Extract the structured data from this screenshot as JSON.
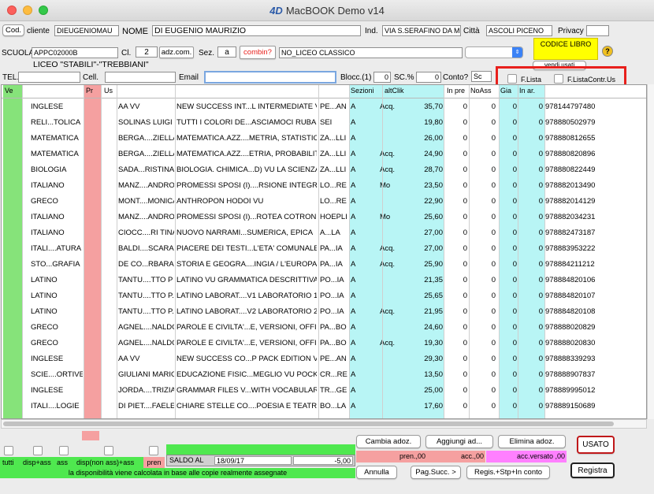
{
  "window": {
    "title": "MacBOOK  Demo v14",
    "logo": "4D"
  },
  "cliente": {
    "cod_btn": "Cod.",
    "label": "cliente",
    "code": "DIEUGENIOMAU",
    "nome_label": "NOME",
    "nome": "DI EUGENIO MAURIZIO",
    "ind_label": "Ind.",
    "ind": "VIA S.SERAFINO DA MO",
    "citta_label": "Città",
    "citta": "ASCOLI PICENO",
    "privacy_label": "Privacy",
    "privacy": ""
  },
  "scuola": {
    "label": "SCUOLA",
    "code": "APPC02000B",
    "cl_label": "Cl.",
    "cl": "2",
    "adz_btn": "adz.com.",
    "sez_label": "Sez.",
    "sez": "a",
    "combin_btn": "combin?",
    "tipo": "NO_LICEO CLASSICO",
    "nome": "LICEO \"STABILI\"-\"TREBBIANI\"",
    "codice_libro": "CODICE LIBRO",
    "help": "?"
  },
  "contatti": {
    "tel_label": "TEL.",
    "tel": "",
    "cell_label": "Cell.",
    "cell": "",
    "email_label": "Email",
    "email": "",
    "blocc_label": "Blocc.(1)",
    "blocc": "0",
    "sc_label": "SC.%",
    "sc": "0",
    "conto_label": "Conto?",
    "conto": "Sc",
    "vendi_btn": "vendi usati"
  },
  "filters": {
    "flista": "F.Lista",
    "flistacontr": "F.ListaContr.Us"
  },
  "colors": {
    "green": "#86e37a",
    "pink": "#f5a0a0",
    "cyan": "#b8f5f5",
    "magenta": "#ff80ff",
    "red_frame": "#e8201c"
  },
  "headers": [
    "Ve",
    "",
    "Pr",
    "Us",
    "",
    "",
    "",
    "",
    "Sezioni",
    "altClik",
    "",
    "In pre",
    "NoAss",
    "Gia",
    "In ar.",
    ""
  ],
  "rows": [
    {
      "mat": "INGLESE",
      "aut": "AA VV",
      "tit": "NEW SUCCESS INT...L INTERMEDIATE VU",
      "ed": "PE...AN",
      "sez": "A",
      "alt": "Acq.",
      "pr": "35,70",
      "inpre": "0",
      "noass": "0",
      "gia": "0",
      "inar": "0",
      "isbn": "978144797480"
    },
    {
      "mat": "RELI...TOLICA",
      "aut": "SOLINAS LUIGI",
      "tit": "TUTTI I COLORI DE...ASCIAMOCI RUBARE",
      "ed": "SEI",
      "sez": "A",
      "alt": "",
      "pr": "19,80",
      "inpre": "0",
      "noass": "0",
      "gia": "0",
      "inar": "0",
      "isbn": "978880502979"
    },
    {
      "mat": "MATEMATICA",
      "aut": "BERGA....ZIELLA",
      "tit": "MATEMATICA.AZZ....METRIA, STATISTICA",
      "ed": "ZA...LLI",
      "sez": "A",
      "alt": "",
      "pr": "26,00",
      "inpre": "0",
      "noass": "0",
      "gia": "0",
      "inar": "0",
      "isbn": "978880812655"
    },
    {
      "mat": "MATEMATICA",
      "aut": "BERGA....ZIELLA",
      "tit": "MATEMATICA.AZZ....ETRIA, PROBABILITA",
      "ed": "ZA...LLI",
      "sez": "A",
      "alt": "Acq.",
      "pr": "24,90",
      "inpre": "0",
      "noass": "0",
      "gia": "0",
      "inar": "0",
      "isbn": "978880820896"
    },
    {
      "mat": "BIOLOGIA",
      "aut": "SADA...RISTINA",
      "tit": "BIOLOGIA. CHIMICA...D) VU LA SCIENZA",
      "ed": "ZA...LLI",
      "sez": "A",
      "alt": "Acq.",
      "pr": "28,70",
      "inpre": "0",
      "noass": "0",
      "gia": "0",
      "inar": "0",
      "isbn": "978880822449"
    },
    {
      "mat": "ITALIANO",
      "aut": "MANZ....ANDRO",
      "tit": "PROMESSI SPOSI (I)....RSIONE INTEGRALE",
      "ed": "LO...RE",
      "sez": "A",
      "alt": "Mo",
      "pr": "23,50",
      "inpre": "0",
      "noass": "0",
      "gia": "0",
      "inar": "0",
      "isbn": "978882013490"
    },
    {
      "mat": "GRECO",
      "aut": "MONT....MONICA",
      "tit": "ANTHROPON HODOI VU",
      "ed": "LO...RE",
      "sez": "A",
      "alt": "",
      "pr": "22,90",
      "inpre": "0",
      "noass": "0",
      "gia": "0",
      "inar": "0",
      "isbn": "978882014129"
    },
    {
      "mat": "ITALIANO",
      "aut": "MANZ....ANDRO",
      "tit": "PROMESSI SPOSI (I)...ROTEA COTRONEO",
      "ed": "HOEPLI",
      "sez": "A",
      "alt": "Mo",
      "pr": "25,60",
      "inpre": "0",
      "noass": "0",
      "gia": "0",
      "inar": "0",
      "isbn": "978882034231"
    },
    {
      "mat": "ITALIANO",
      "aut": "CIOCC....RI TINA",
      "tit": "NUOVO NARRAMI...SUMERICA, EPICA",
      "ed": "A...LA",
      "sez": "A",
      "alt": "",
      "pr": "27,00",
      "inpre": "0",
      "noass": "0",
      "gia": "0",
      "inar": "0",
      "isbn": "978882473187"
    },
    {
      "mat": "ITALI....ATURA",
      "aut": "BALDI....SCARA",
      "tit": "PIACERE DEI TESTI...L'ETA' COMUNALE",
      "ed": "PA...IA",
      "sez": "A",
      "alt": "Acq.",
      "pr": "27,00",
      "inpre": "0",
      "noass": "0",
      "gia": "0",
      "inar": "0",
      "isbn": "978883953222"
    },
    {
      "mat": "STO...GRAFIA",
      "aut": "DE CO...RBARA",
      "tit": "STORIA E GEOGRA....INGIA / L'EUROPA E",
      "ed": "PA...IA",
      "sez": "A",
      "alt": "Acq.",
      "pr": "25,90",
      "inpre": "0",
      "noass": "0",
      "gia": "0",
      "inar": "0",
      "isbn": "978884211212"
    },
    {
      "mat": "LATINO",
      "aut": "TANTU....TTO P",
      "tit": "LATINO VU GRAMMATICA DESCRITTIVA",
      "ed": "PO...IA",
      "sez": "A",
      "alt": "",
      "pr": "21,35",
      "inpre": "0",
      "noass": "0",
      "gia": "0",
      "inar": "0",
      "isbn": "978884820106"
    },
    {
      "mat": "LATINO",
      "aut": "TANTU....TTO P.",
      "tit": "LATINO LABORAT....V1 LABORATORIO 1",
      "ed": "PO...IA",
      "sez": "A",
      "alt": "",
      "pr": "25,65",
      "inpre": "0",
      "noass": "0",
      "gia": "0",
      "inar": "0",
      "isbn": "978884820107"
    },
    {
      "mat": "LATINO",
      "aut": "TANTU....TTO P.",
      "tit": "LATINO LABORAT....V2 LABORATORIO 2",
      "ed": "PO...IA",
      "sez": "A",
      "alt": "Acq.",
      "pr": "21,95",
      "inpre": "0",
      "noass": "0",
      "gia": "0",
      "inar": "0",
      "isbn": "978884820108"
    },
    {
      "mat": "GRECO",
      "aut": "AGNEL....NALDO",
      "tit": "PAROLE E CIVILTA'...E, VERSIONI, OFFIC",
      "ed": "PA...BO",
      "sez": "A",
      "alt": "",
      "pr": "24,60",
      "inpre": "0",
      "noass": "0",
      "gia": "0",
      "inar": "0",
      "isbn": "978888020829"
    },
    {
      "mat": "GRECO",
      "aut": "AGNEL....NALDO",
      "tit": "PAROLE E CIVILTA'...E, VERSIONI, OFFIC",
      "ed": "PA...BO",
      "sez": "A",
      "alt": "Acq.",
      "pr": "19,30",
      "inpre": "0",
      "noass": "0",
      "gia": "0",
      "inar": "0",
      "isbn": "978888020830"
    },
    {
      "mat": "INGLESE",
      "aut": "AA VV",
      "tit": "NEW SUCCESS CO...P PACK EDITION VU",
      "ed": "PE...AN",
      "sez": "A",
      "alt": "",
      "pr": "29,30",
      "inpre": "0",
      "noass": "0",
      "gia": "0",
      "inar": "0",
      "isbn": "978888339293"
    },
    {
      "mat": "SCIE....ORTIVE",
      "aut": "GIULIANI MARIO",
      "tit": "EDUCAZIONE FISIC...MEGLIO VU POCKET",
      "ed": "CR...RE",
      "sez": "A",
      "alt": "",
      "pr": "13,50",
      "inpre": "0",
      "noass": "0",
      "gia": "0",
      "inar": "0",
      "isbn": "978888907837"
    },
    {
      "mat": "INGLESE",
      "aut": "JORDA....TRIZIA",
      "tit": "GRAMMAR FILES V...WITH VOCABULARY",
      "ed": "TR...GE",
      "sez": "A",
      "alt": "",
      "pr": "25,00",
      "inpre": "0",
      "noass": "0",
      "gia": "0",
      "inar": "0",
      "isbn": "978889995012"
    },
    {
      "mat": "ITALI....LOGIE",
      "aut": "DI PIET....FAELE",
      "tit": "CHIARE STELLE CO....POESIA E TEATRO",
      "ed": "BO...LA",
      "sez": "A",
      "alt": "",
      "pr": "17,60",
      "inpre": "0",
      "noass": "0",
      "gia": "0",
      "inar": "0",
      "isbn": "978889150689"
    }
  ],
  "bottom": {
    "cambia": "Cambia adoz.",
    "aggiungi": "Aggiungi ad...",
    "elimina": "Elimina adoz.",
    "usato": "USATO",
    "tutti": "tutti",
    "disp_ass": "disp+ass",
    "ass": "ass",
    "disp_non": "disp(non ass)+ass",
    "pren": "pren",
    "saldo_label": "SALDO AL",
    "saldo_date": "18/09/17",
    "saldo_val": "-5,00",
    "pren_val": "pren.,00",
    "acc_val": "acc.,00",
    "acc_versato": "acc.versato ,00",
    "note": "la disponibilità viene calcolata in base alle copie realmente assegnate",
    "annulla": "Annulla",
    "pag_succ": "Pag.Succ. >",
    "regis_stp": "Regis.+Stp+In conto",
    "registra": "Registra"
  }
}
